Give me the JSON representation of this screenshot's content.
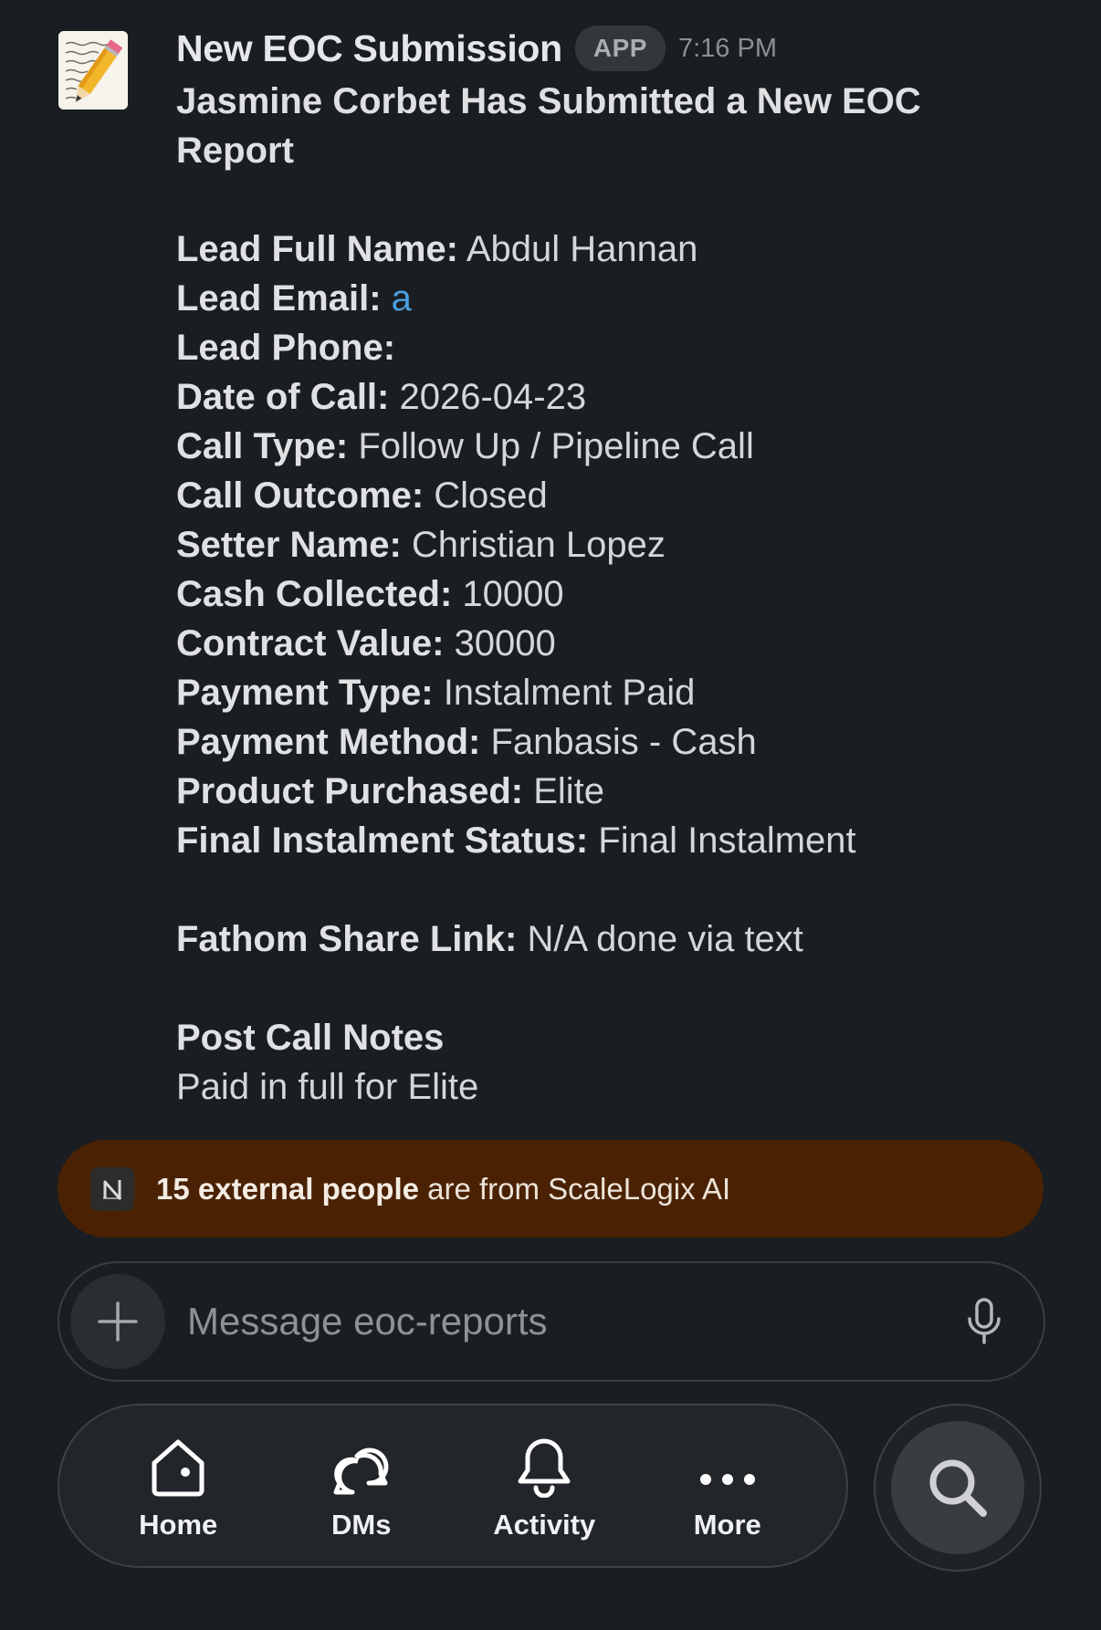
{
  "message": {
    "sender": "New EOC Submission",
    "badge": "APP",
    "time": "7:16 PM",
    "headline": "Jasmine Corbet Has Submitted a New EOC Report",
    "fields": [
      {
        "label": "Lead Full Name:",
        "value": "Abdul Hannan"
      },
      {
        "label": "Lead Email:",
        "value": "a"
      },
      {
        "label": "Lead Phone:",
        "value": ""
      },
      {
        "label": "Date of Call:",
        "value": "2026-04-23"
      },
      {
        "label": "Call Type:",
        "value": "Follow Up / Pipeline Call"
      },
      {
        "label": "Call Outcome:",
        "value": "Closed"
      },
      {
        "label": "Setter Name:",
        "value": "Christian Lopez"
      },
      {
        "label": "Cash Collected:",
        "value": "10000"
      },
      {
        "label": "Contract Value:",
        "value": "30000"
      },
      {
        "label": "Payment Type:",
        "value": "Instalment Paid"
      },
      {
        "label": "Payment Method:",
        "value": "Fanbasis - Cash"
      },
      {
        "label": "Product Purchased:",
        "value": "Elite"
      },
      {
        "label": "Final Instalment Status:",
        "value": "Final Instalment"
      }
    ],
    "fathom": {
      "label": "Fathom Share Link:",
      "value": "N/A done via text"
    },
    "notes_title": "Post Call Notes",
    "notes_text": "Paid in full for Elite"
  },
  "banner": {
    "bold_text": "15 external people",
    "rest_text": "are from ScaleLogix AI"
  },
  "composer": {
    "placeholder": "Message eoc-reports"
  },
  "nav": {
    "home": "Home",
    "dms": "DMs",
    "activity": "Activity",
    "more": "More"
  },
  "colors": {
    "background": "#1a1d21",
    "banner": "#4a2203",
    "link": "#4aa0e0"
  }
}
